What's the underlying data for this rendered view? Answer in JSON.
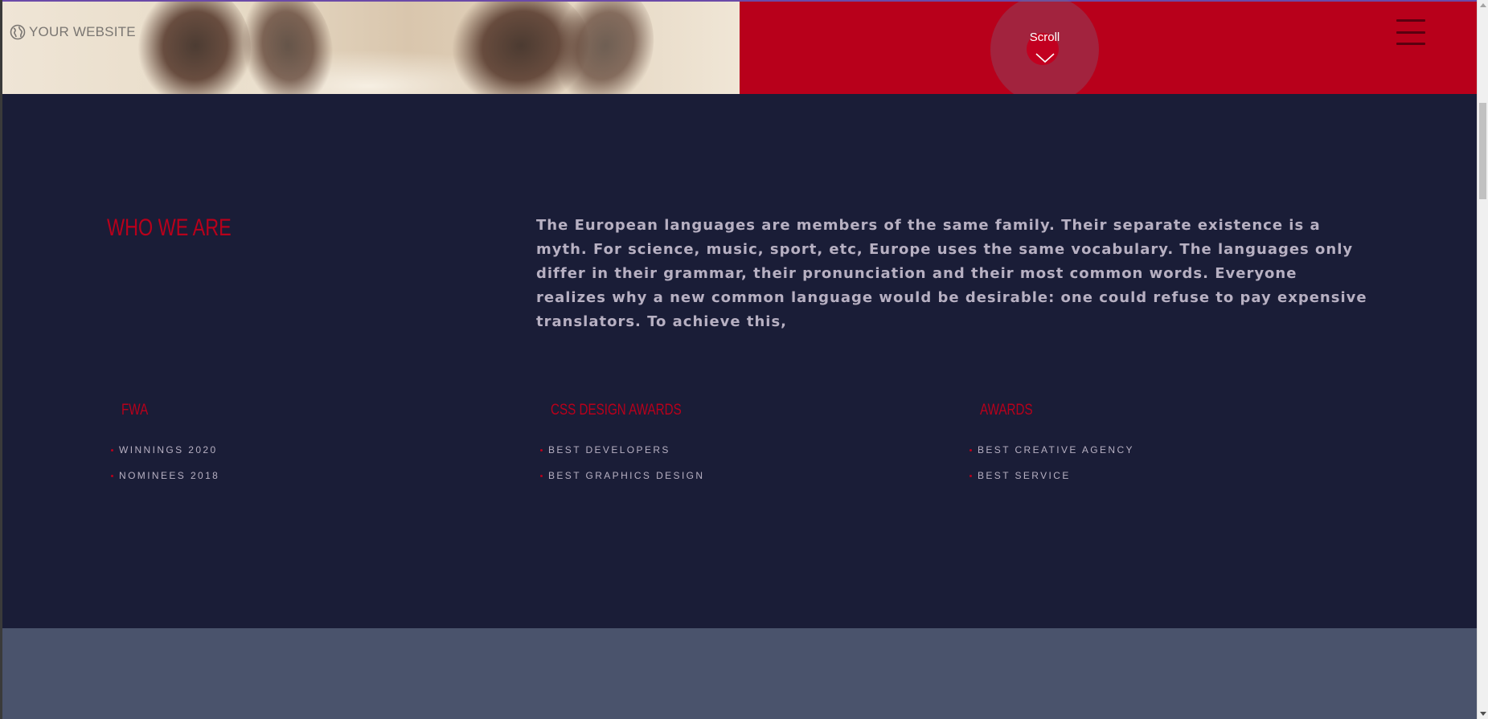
{
  "header": {
    "logo_text": "YOUR WEBSITE",
    "logo_icon": "globe-icon",
    "menu_icon": "hamburger-menu-icon",
    "scroll_label": "Scroll",
    "scroll_icon": "chevron-down-icon"
  },
  "colors": {
    "accent_red": "#b8001b",
    "section_bg": "#1a1d37",
    "body_text": "#b7b0c2",
    "next_section_bg": "#4a536c"
  },
  "about": {
    "title": "WHO WE ARE",
    "intro": "The European languages are members of the same family. Their separate existence is a myth. For science, music, sport, etc, Europe uses the same vocabulary. The languages only differ in their grammar, their pronunciation and their most common words. Everyone realizes why a new common language would be desirable: one could refuse to pay expensive translators. To achieve this,"
  },
  "awards": [
    {
      "title": "FWA",
      "items": [
        "WINNINGS 2020",
        "NOMINEES 2018"
      ]
    },
    {
      "title": "CSS DESIGN AWARDS",
      "items": [
        "BEST DEVELOPERS",
        "BEST GRAPHICS DESIGN"
      ]
    },
    {
      "title": "AWARDS",
      "items": [
        "BEST CREATIVE AGENCY",
        "BEST SERVICE"
      ]
    }
  ]
}
